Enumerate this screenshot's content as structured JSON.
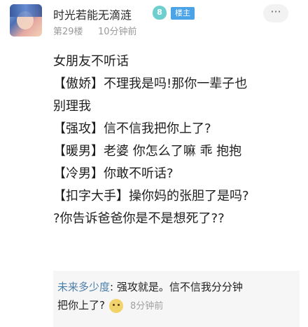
{
  "post": {
    "username": "时光若能无滴涟",
    "level": "8",
    "owner_tag": "楼主",
    "floor": "第29楼",
    "time": "10分钟前",
    "more_icon": "···",
    "content_lines": [
      "女朋友不听话",
      "【傲娇】不理我是吗!那你一辈子也",
      "别理我",
      "【强攻】信不信我把你上了?",
      "【暖男】老婆 你怎么了嘛 乖 抱抱",
      "【冷男】你敢不听话?",
      "【扣字大手】操你妈的张胆了是吗?",
      "?你告诉爸爸你是不是想死了??"
    ]
  },
  "reply": {
    "user": "未来多少度",
    "separator": ":",
    "text_line1": "强攻就是。信不信我分分钟",
    "text_line2": "把你上了?",
    "time": "8分钟前",
    "emoji": "smiley-emoji"
  }
}
